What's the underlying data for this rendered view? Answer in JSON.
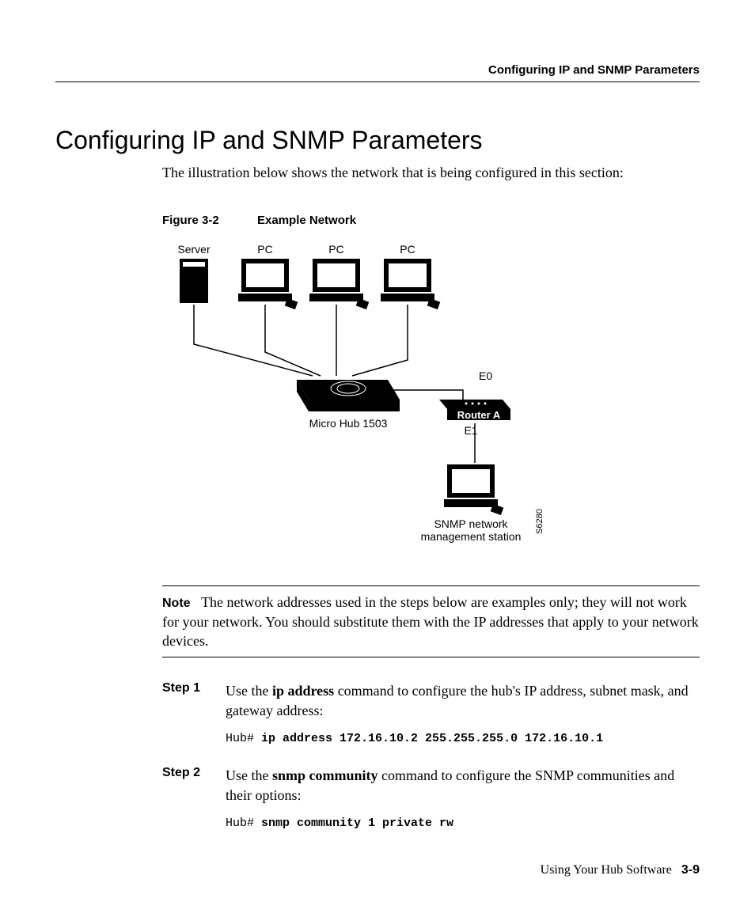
{
  "header": {
    "running_head": "Configuring IP and SNMP Parameters"
  },
  "title": "Configuring IP and SNMP Parameters",
  "intro": "The illustration below shows the network that is being configured in this section:",
  "figure": {
    "number": "Figure 3-2",
    "title": "Example Network",
    "labels": {
      "server": "Server",
      "pc": "PC",
      "hub": "Micro Hub 1503",
      "router": "Router A",
      "e0": "E0",
      "e1": "E1",
      "snmp1": "SNMP network",
      "snmp2": "management station",
      "code": "S6280"
    }
  },
  "note": {
    "label": "Note",
    "text": "The network addresses used in the steps below are examples only; they will not work for your network. You should substitute them with the IP addresses that apply to your network devices."
  },
  "steps": [
    {
      "label": "Step 1",
      "pre": "Use the ",
      "cmd": "ip address",
      "post": " command to configure the hub's IP address, subnet mask, and gateway address:",
      "cli_prompt": "Hub# ",
      "cli_cmd": "ip address 172.16.10.2 255.255.255.0 172.16.10.1"
    },
    {
      "label": "Step 2",
      "pre": "Use the ",
      "cmd": "snmp community",
      "post": " command to configure the SNMP communities and their options:",
      "cli_prompt": "Hub# ",
      "cli_cmd": "snmp community 1 private rw"
    }
  ],
  "footer": {
    "text": "Using Your Hub Software",
    "page": "3-9"
  }
}
